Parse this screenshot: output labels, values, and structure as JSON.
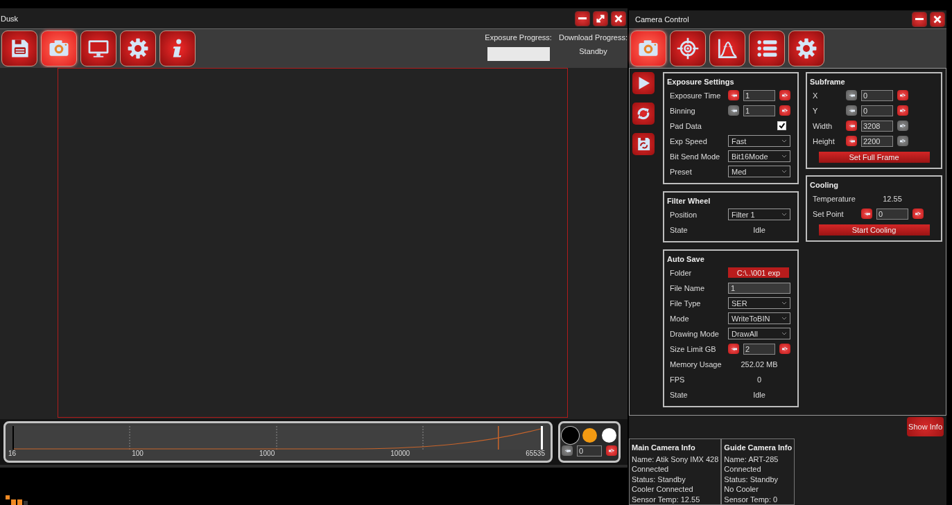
{
  "main_window": {
    "title": "Dusk",
    "toolbar": [
      {
        "kind": "save",
        "selected": false
      },
      {
        "kind": "camera",
        "selected": true
      },
      {
        "kind": "monitor",
        "selected": false
      },
      {
        "kind": "gear",
        "selected": false
      },
      {
        "kind": "info",
        "selected": false
      }
    ],
    "progress": {
      "exposure_label": "Exposure Progress:",
      "exposure_bar": {
        "level": 0
      },
      "download_label": "Download Progress:",
      "download_status": "Standby"
    },
    "histogram": {
      "axis_labels": [
        "16",
        "100",
        "1000",
        "10000",
        "65535"
      ]
    },
    "channel_picker": {
      "channels": [
        {
          "color": "#000000",
          "selected": true
        },
        {
          "color": "#f39a12",
          "selected": false
        },
        {
          "color": "#ffffff",
          "selected": false
        }
      ],
      "value": "0",
      "dec_disabled": true,
      "inc_disabled": false
    }
  },
  "camera_window": {
    "title": "Camera Control",
    "toolbar": [
      {
        "kind": "camera",
        "selected": true
      },
      {
        "kind": "target",
        "selected": false
      },
      {
        "kind": "curve",
        "selected": false
      },
      {
        "kind": "list",
        "selected": false
      },
      {
        "kind": "gear",
        "selected": false
      }
    ],
    "actions": [
      {
        "kind": "play"
      },
      {
        "kind": "refresh"
      },
      {
        "kind": "save-refresh"
      }
    ],
    "panels_left": [
      {
        "title": "Exposure Settings",
        "rows": [
          {
            "kind": "stepper",
            "label": "Exposure Time",
            "value": "1",
            "dec_disabled": false,
            "inc_disabled": false
          },
          {
            "kind": "stepper",
            "label": "Binning",
            "value": "1",
            "dec_disabled": true,
            "inc_disabled": false
          },
          {
            "kind": "checkbox",
            "label": "Pad Data",
            "checked": true
          },
          {
            "kind": "select",
            "label": "Exp Speed",
            "value": "Fast"
          },
          {
            "kind": "select",
            "label": "Bit Send Mode",
            "value": "Bit16Mode"
          },
          {
            "kind": "select",
            "label": "Preset",
            "value": "Med"
          }
        ]
      },
      {
        "title": "Filter Wheel",
        "rows": [
          {
            "kind": "select",
            "label": "Position",
            "value": "Filter 1"
          },
          {
            "kind": "value",
            "label": "State",
            "value": "Idle"
          }
        ]
      },
      {
        "title": "Auto Save",
        "rows": [
          {
            "kind": "path",
            "label": "Folder",
            "value": "C:\\..\\001 exp"
          },
          {
            "kind": "input",
            "label": "File Name",
            "value": "1"
          },
          {
            "kind": "select",
            "label": "File Type",
            "value": "SER"
          },
          {
            "kind": "select",
            "label": "Mode",
            "value": "WriteToBIN"
          },
          {
            "kind": "select",
            "label": "Drawing Mode",
            "value": "DrawAll"
          },
          {
            "kind": "stepper",
            "label": "Size Limit GB",
            "value": "2",
            "dec_disabled": false,
            "inc_disabled": false
          },
          {
            "kind": "value",
            "label": "Memory Usage",
            "value": "252.02 MB"
          },
          {
            "kind": "value",
            "label": "FPS",
            "value": "0"
          },
          {
            "kind": "value",
            "label": "State",
            "value": "Idle"
          }
        ]
      }
    ],
    "panels_right": [
      {
        "title": "Subframe",
        "rows": [
          {
            "kind": "stepper",
            "label": "X",
            "value": "0",
            "dec_disabled": true,
            "inc_disabled": false
          },
          {
            "kind": "stepper",
            "label": "Y",
            "value": "0",
            "dec_disabled": true,
            "inc_disabled": false
          },
          {
            "kind": "stepper",
            "label": "Width",
            "value": "3208",
            "dec_disabled": false,
            "inc_disabled": true
          },
          {
            "kind": "stepper",
            "label": "Height",
            "value": "2200",
            "dec_disabled": false,
            "inc_disabled": true
          },
          {
            "kind": "action",
            "label": "Set Full Frame"
          }
        ]
      },
      {
        "title": "Cooling",
        "rows": [
          {
            "kind": "value",
            "label": "Temperature",
            "value": "12.55"
          },
          {
            "kind": "stepper",
            "label": "Set Point",
            "value": "0",
            "dec_disabled": false,
            "inc_disabled": false
          },
          {
            "kind": "action",
            "label": "Start Cooling"
          }
        ]
      }
    ],
    "show_info_button": "Show Info",
    "info_panels": [
      {
        "title": "Main Camera Info",
        "lines": [
          "Name: Atik Sony IMX 428",
          "Connected",
          "Status: Standby",
          "Cooler Connected",
          "Sensor Temp: 12.55"
        ]
      },
      {
        "title": "Guide Camera Info",
        "lines": [
          "Name: ART-285",
          "Connected",
          "Status: Standby",
          "No Cooler",
          "Sensor Temp: 0"
        ]
      }
    ]
  }
}
